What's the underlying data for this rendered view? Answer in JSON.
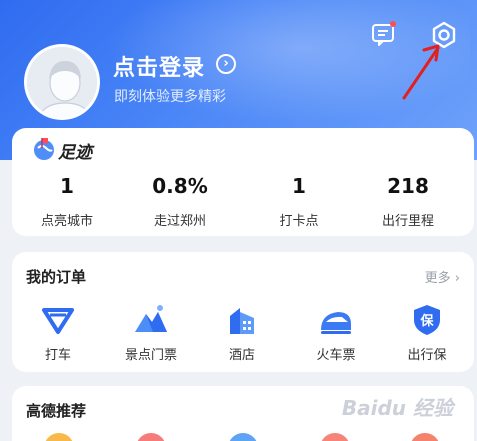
{
  "header": {
    "login_title": "点击登录",
    "login_subtitle": "即刻体验更多精彩",
    "icons": [
      "message-icon",
      "settings-icon",
      "chevron-right-icon"
    ],
    "accent_color": "#3c7af3"
  },
  "footprint": {
    "title": "足迹",
    "stats": [
      {
        "value": "1",
        "label": "点亮城市"
      },
      {
        "value": "0.8%",
        "label": "走过郑州"
      },
      {
        "value": "1",
        "label": "打卡点"
      },
      {
        "value": "218",
        "label": "出行里程"
      }
    ]
  },
  "orders": {
    "title": "我的订单",
    "more": "更多",
    "items": [
      {
        "label": "打车",
        "icon": "taxi-icon"
      },
      {
        "label": "景点门票",
        "icon": "mountain-icon"
      },
      {
        "label": "酒店",
        "icon": "hotel-icon"
      },
      {
        "label": "火车票",
        "icon": "train-icon"
      },
      {
        "label": "出行保",
        "icon": "shield-icon"
      }
    ]
  },
  "recommend": {
    "title": "高德推荐"
  },
  "watermark": "Baidu 经验"
}
